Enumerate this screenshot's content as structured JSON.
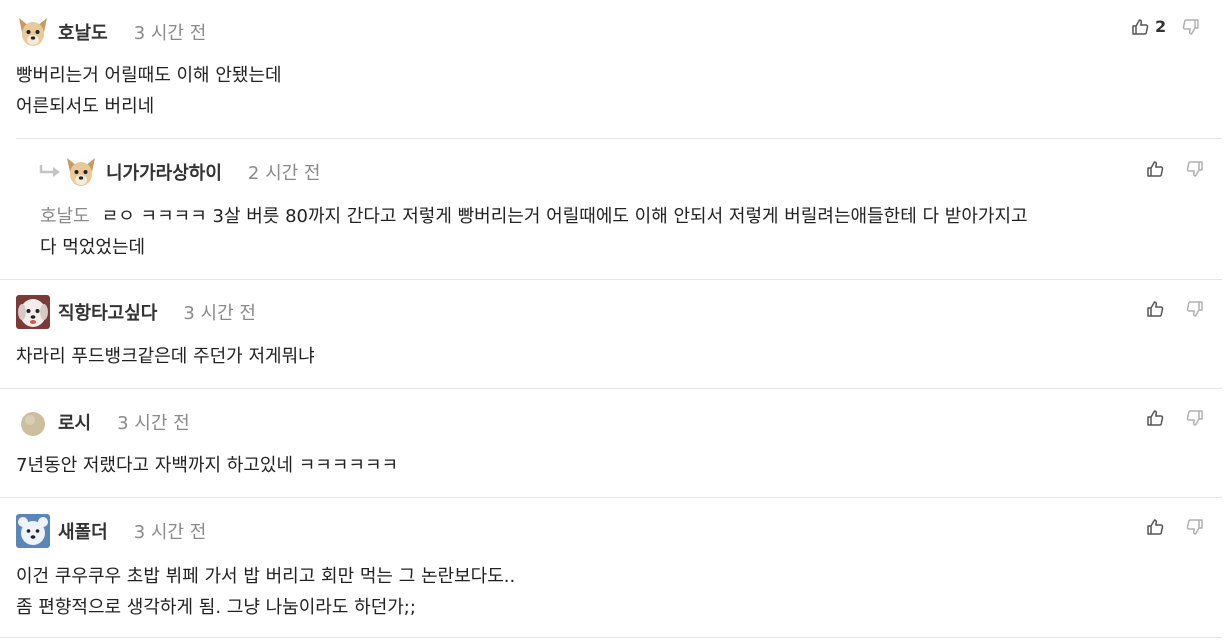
{
  "comments": [
    {
      "nickname": "호날도",
      "time": "3 시간 전",
      "lines": [
        "빵버리는거 어릴때도 이해 안됐는데",
        "어른되서도 버리네"
      ],
      "upvotes": "2",
      "avatar": "dog-avatar-icon"
    },
    {
      "nickname": "니가가라상하이",
      "time": "2 시간 전",
      "mention": "호날도",
      "lines": [
        "ㄹㅇ ㅋㅋㅋㅋ 3살 버릇 80까지 간다고 저렇게 빵버리는거 어릴때에도 이해 안되서 저렇게 버릴려는애들한테 다 받아가지고",
        "다 먹었었는데"
      ],
      "upvotes": "",
      "avatar": "dog-avatar-icon"
    },
    {
      "nickname": "직항타고싶다",
      "time": "3 시간 전",
      "lines": [
        "차라리 푸드뱅크같은데 주던가 저게뭐냐"
      ],
      "upvotes": "",
      "avatar": "puppy-avatar-icon"
    },
    {
      "nickname": "로시",
      "time": "3 시간 전",
      "lines": [
        "7년동안 저랬다고 자백까지 하고있네 ㅋㅋㅋㅋㅋㅋ"
      ],
      "upvotes": "",
      "avatar": "default-circle-avatar-icon"
    },
    {
      "nickname": "새폴더",
      "time": "3 시간 전",
      "lines": [
        "이건 쿠우쿠우 초밥 뷔페 가서 밥 버리고 회만 먹는 그 논란보다도..",
        "좀 편향적으로 생각하게 됨. 그냥 나눔이라도 하던가;;"
      ],
      "upvotes": "",
      "avatar": "bear-avatar-icon"
    }
  ],
  "colors": {
    "text": "#222222",
    "muted": "#8a8a8a",
    "divider": "#e6e6e6",
    "icon": "#555555",
    "icon_light": "#b0b0b0"
  }
}
